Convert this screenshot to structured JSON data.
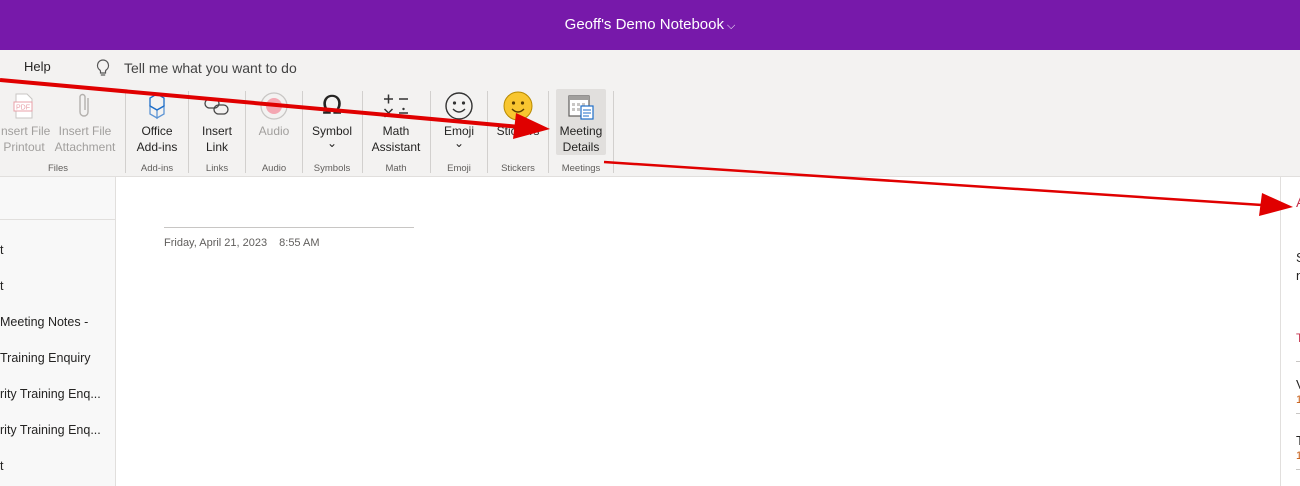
{
  "titlebar": {
    "title": "Geoff's Demo Notebook",
    "dropdown_icon": "chevron-down-icon"
  },
  "menubar": {
    "help": "Help",
    "tellme_placeholder": "Tell me what you want to do",
    "search_icon": "lightbulb-icon"
  },
  "ribbon": {
    "files": {
      "insert_printout": "Insert File\nPrintout",
      "insert_attachment": "Insert File\nAttachment",
      "group": "Files"
    },
    "addins": {
      "office_addins": "Office\nAdd-ins",
      "group": "Add-ins"
    },
    "links": {
      "insert_link": "Insert\nLink",
      "group": "Links"
    },
    "audio": {
      "audio": "Audio",
      "group": "Audio"
    },
    "symbols": {
      "symbol": "Symbol",
      "chevron": "⌄",
      "group": "Symbols"
    },
    "math": {
      "math_assistant": "Math\nAssistant",
      "group": "Math"
    },
    "emoji": {
      "emoji": "Emoji",
      "chevron": "⌄",
      "group": "Emoji"
    },
    "stickers": {
      "stickers": "Stickers",
      "group": "Stickers"
    },
    "meetings": {
      "meeting_details": "Meeting\nDetails",
      "group": "Meetings"
    }
  },
  "sidebar": {
    "pages": [
      "t",
      "t",
      "Meeting Notes -",
      "Training Enquiry",
      "rity Training Enq...",
      "rity Training Enq...",
      "t"
    ]
  },
  "page": {
    "date": "Friday, April 21, 2023",
    "time": "8:55 AM"
  },
  "right_pane": {
    "heading": "A",
    "line1": "S",
    "line2": "n",
    "section": "T",
    "item1": "V",
    "item1_sub": "1",
    "item2": "T",
    "item2_sub": "1"
  },
  "colors": {
    "accent": "#7719aa",
    "arrow": "#e00000"
  }
}
